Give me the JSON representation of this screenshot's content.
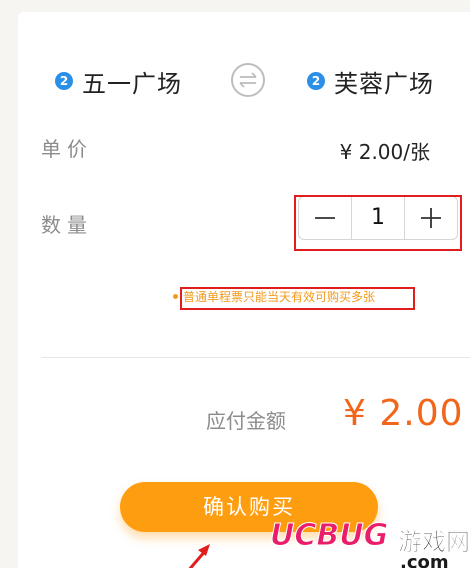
{
  "route": {
    "from": {
      "line": "2",
      "name": "五一广场"
    },
    "to": {
      "line": "2",
      "name": "芙蓉广场"
    },
    "swap_icon": "swap-arrows-icon"
  },
  "unit_price": {
    "label": "单价",
    "value": "¥ 2.00/张"
  },
  "quantity": {
    "label": "数量",
    "value": "1",
    "minus_icon": "minus-icon",
    "plus_icon": "plus-icon"
  },
  "notice": "普通单程票只能当天有效可购买多张",
  "total": {
    "label": "应付金额",
    "amount": "¥ 2.00"
  },
  "confirm_button": "确认购买",
  "watermark": {
    "brand": "UCBUG",
    "cn": "游戏网",
    "domain": ".com"
  },
  "colors": {
    "accent_orange": "#ff9d10",
    "total_orange": "#f1661b",
    "notice_orange": "#f39a1c",
    "line_badge_blue": "#2b8fe8",
    "highlight_red": "#e01e1e"
  }
}
